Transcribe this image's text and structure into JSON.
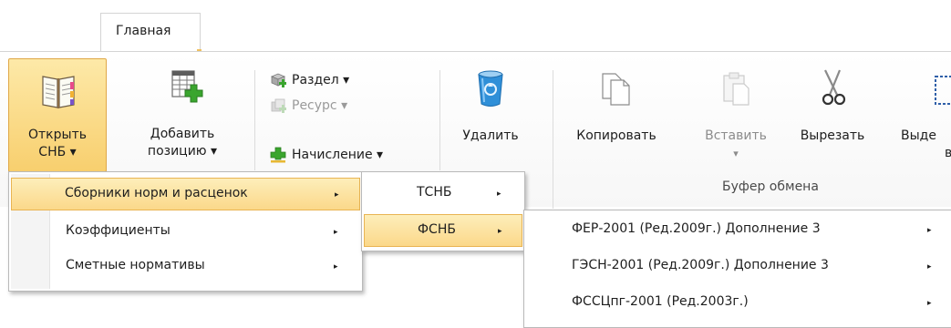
{
  "ribbon_tab": {
    "label": "Главная"
  },
  "buttons": {
    "open": {
      "line1": "Открыть",
      "line2": "СНБ ▾"
    },
    "add": {
      "line1": "Добавить",
      "line2": "позицию ▾"
    },
    "section": "Раздел ▾",
    "resource": "Ресурс ▾",
    "charge": "Начисление ▾",
    "delete": "Удалить",
    "copy": "Копировать",
    "paste": {
      "line1": "Вставить",
      "line2": "▾"
    },
    "cut": "Вырезать",
    "select": {
      "line1": "Выде",
      "line2": "в"
    }
  },
  "groups": {
    "clipboard": "Буфер обмена"
  },
  "menu1": {
    "items": [
      {
        "label": "Сборники норм и расценок",
        "arrow": "▸"
      },
      {
        "label": "Коэффициенты",
        "arrow": "▸"
      },
      {
        "label": "Сметные нормативы",
        "arrow": "▸"
      }
    ]
  },
  "menu2": {
    "items": [
      {
        "label": "ТСНБ",
        "arrow": "▸"
      },
      {
        "label": "ФСНБ",
        "arrow": "▸"
      }
    ]
  },
  "menu3": {
    "items": [
      {
        "label": "ФЕР-2001 (Ред.2009г.) Дополнение 3",
        "arrow": "▸"
      },
      {
        "label": "ГЭСН-2001 (Ред.2009г.) Дополнение 3",
        "arrow": "▸"
      },
      {
        "label": "ФССЦпг-2001 (Ред.2003г.)",
        "arrow": "▸"
      }
    ]
  },
  "colors": {
    "highlight": "#fbd88a",
    "accent_green": "#3aa52e",
    "recycle_blue": "#2f8fd8"
  }
}
